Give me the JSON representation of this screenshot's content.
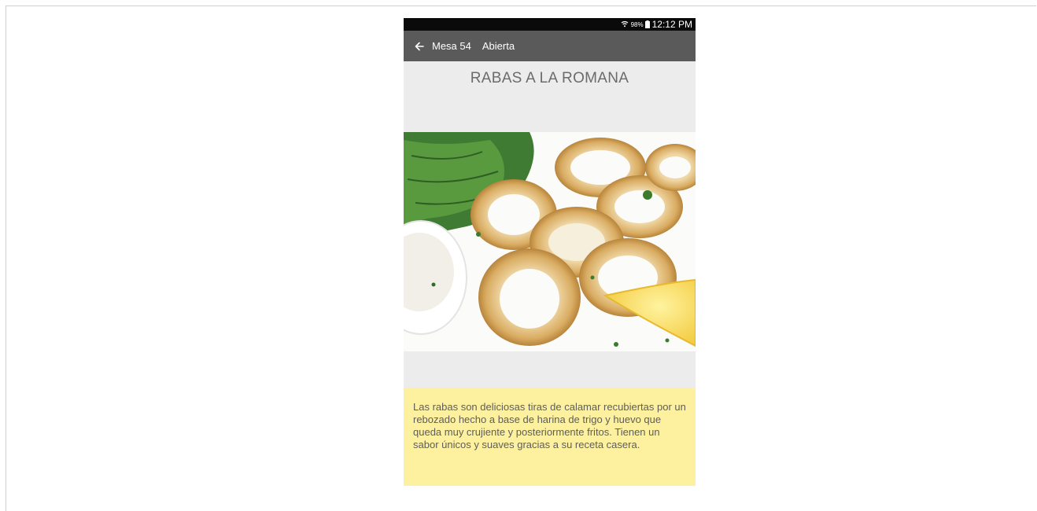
{
  "status_bar": {
    "battery": "98%",
    "time": "12:12 PM"
  },
  "app_bar": {
    "title": "Mesa 54",
    "status": "Abierta"
  },
  "dish": {
    "name": "RABAS A LA ROMANA",
    "description": "Las rabas son deliciosas tiras de calamar recubiertas por un rebozado hecho a base de harina de trigo y huevo que queda muy crujiente y posteriormente fritos. Tienen un sabor  únicos y suaves gracias a su receta casera."
  },
  "colors": {
    "app_bar": "#5a5a5a",
    "status_bar": "#0a0a0a",
    "screen_bg": "#ececec",
    "description_bg": "#fdf1a0"
  }
}
